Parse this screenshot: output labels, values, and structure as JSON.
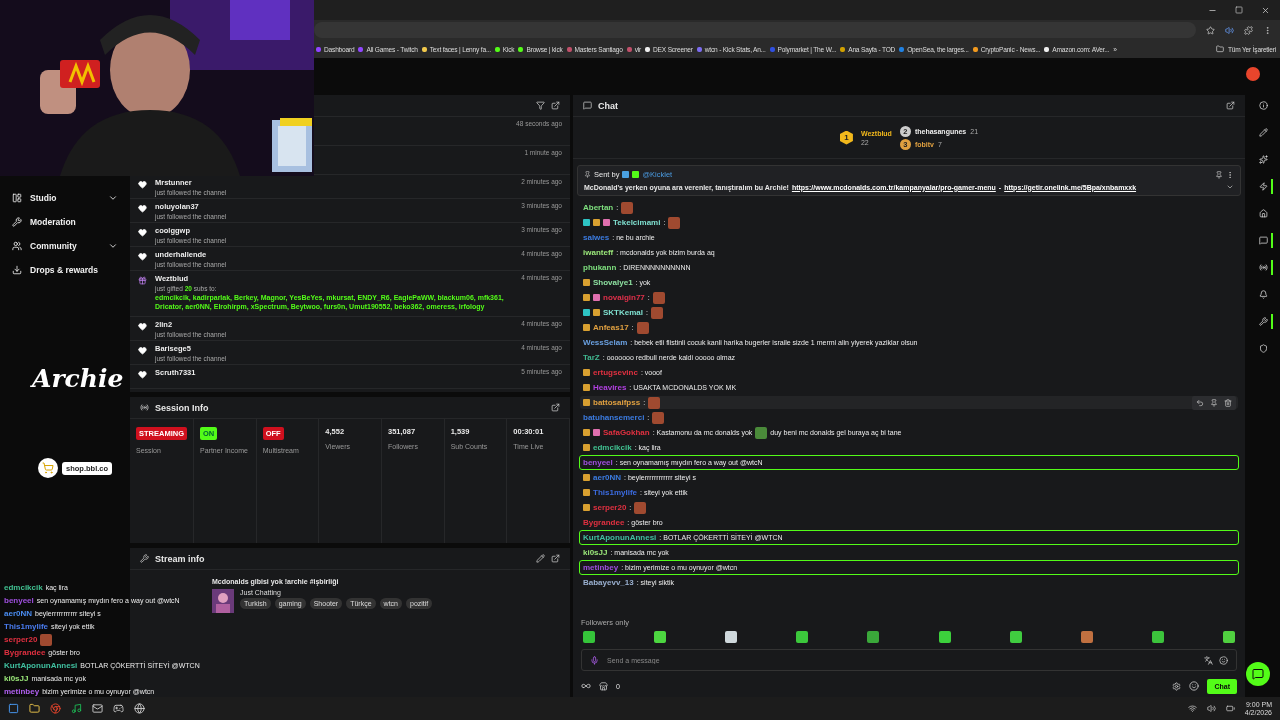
{
  "bookmarks": [
    {
      "label": "Dashboard"
    },
    {
      "label": "All Games - Twitch"
    },
    {
      "label": "Text faces | Lenny fa..."
    },
    {
      "label": "Kick"
    },
    {
      "label": "Browse | kick"
    },
    {
      "label": "Masters Santiago"
    },
    {
      "label": "vlr"
    },
    {
      "label": "DEX Screener"
    },
    {
      "label": "wtcn - Kick Stats, An..."
    },
    {
      "label": "Polymarket | The W..."
    },
    {
      "label": "Ana Sayfa - TOD"
    },
    {
      "label": "OpenSea, the larges..."
    },
    {
      "label": "CryptoPanic - News..."
    },
    {
      "label": "Amazon.com: AVer..."
    }
  ],
  "bookmarks_more": "»",
  "bookmarks_all": "Tüm Yer İşaretleri",
  "sidebar": {
    "items": [
      {
        "label": "Studio",
        "has_submenu": true
      },
      {
        "label": "Moderation",
        "has_submenu": false
      },
      {
        "label": "Community",
        "has_submenu": true
      },
      {
        "label": "Drops & rewards",
        "has_submenu": false
      }
    ]
  },
  "activity_feed": {
    "items": [
      {
        "kind": "hidden",
        "time": "48 seconds ago"
      },
      {
        "kind": "hidden",
        "time": "1 minute ago"
      },
      {
        "kind": "follow",
        "name": "Mrstunner",
        "note": "just followed the channel",
        "time": "2 minutes ago"
      },
      {
        "kind": "follow",
        "name": "noluyolan37",
        "note": "just followed the channel",
        "time": "3 minutes ago"
      },
      {
        "kind": "follow",
        "name": "coolggwp",
        "note": "just followed the channel",
        "time": "3 minutes ago"
      },
      {
        "kind": "follow",
        "name": "underhallende",
        "note": "just followed the channel",
        "time": "4 minutes ago"
      },
      {
        "kind": "gift",
        "name": "Weztblud",
        "note": "just gifted **20** subs to:",
        "recipients": "edmcikcik, kadirparlak, Berkey, Magnor, YesBeYes, mkursat, ENDY_R6, EaglePaWW, blackum06, mfk361, Dricator, aer0NN, Elrohirpm, xSpectrum, Beytwoo, furs0n, Umut190552, beko362, omeress, irfology",
        "time": "4 minutes ago"
      },
      {
        "kind": "follow",
        "name": "2lin2",
        "note": "just followed the channel",
        "time": "4 minutes ago"
      },
      {
        "kind": "follow",
        "name": "Barisege5",
        "note": "just followed the channel",
        "time": "4 minutes ago"
      },
      {
        "kind": "follow",
        "name": "Scruth7331",
        "time": "5 minutes ago"
      }
    ]
  },
  "session_info": {
    "title": "Session Info",
    "cells": [
      {
        "kind": "badge",
        "badge": "STREAMING",
        "color": "#d0101e",
        "label": "Session"
      },
      {
        "kind": "badge",
        "badge": "ON",
        "color": "#53fc18",
        "label": "Partner Income"
      },
      {
        "kind": "badge",
        "badge": "OFF",
        "color": "#d0101e",
        "label": "Multistream"
      },
      {
        "kind": "stat",
        "value": "4,552",
        "label": "Viewers"
      },
      {
        "kind": "stat",
        "value": "351,087",
        "label": "Followers"
      },
      {
        "kind": "stat",
        "value": "1,539",
        "label": "Sub Counts"
      },
      {
        "kind": "stat",
        "value": "00:30:01",
        "label": "Time Live"
      }
    ]
  },
  "stream_info": {
    "title": "Stream info",
    "stream_title": "Mcdonalds gibisi yok !archie #işbirliği",
    "category": "Just Chatting",
    "tags": [
      "Turkish",
      "gaming",
      "Shooter",
      "Türkçe",
      "wtcn",
      "pozitif"
    ]
  },
  "overlay": {
    "logo": "Archie",
    "shop": "shop.bbl.co",
    "chat": [
      {
        "user": "edmcikcik",
        "color": "#40c090",
        "text": "kaç lira"
      },
      {
        "user": "benyeel",
        "color": "#a050e0",
        "text": "sen oynamamış mıydın fero a way out @wtcN"
      },
      {
        "user": "aer0NN",
        "color": "#4a8cf0",
        "text": "beylerrrrrrrrrrr siteyi s"
      },
      {
        "user": "This1mylife",
        "color": "#4a7cf0",
        "text": "siteyi yok ettik"
      },
      {
        "user": "serper20",
        "color": "#e03040",
        "emote": true
      },
      {
        "user": "Bygrandee",
        "color": "#e03040",
        "text": "göster bro"
      },
      {
        "user": "KurtAponunAnnesi",
        "color": "#40c0a0",
        "text": "BOTLAR ÇÖKERTTİ SİTEYİ @WTCN"
      },
      {
        "user": "ki0sJJ",
        "color": "#9be87a",
        "text": "manisada mc yok"
      },
      {
        "user": "metinbey",
        "color": "#b060f0",
        "text": "bizim yerimize o mu oynuyor @wtcn"
      }
    ]
  },
  "chat": {
    "title": "Chat",
    "leaderboard": [
      {
        "rank": "1",
        "name": "Weztblud",
        "count": "22"
      },
      {
        "rank": "2",
        "name": "thehasangunes",
        "count": "21"
      },
      {
        "rank": "3",
        "name": "fobitv",
        "count": "7"
      }
    ],
    "pinned": {
      "sent_by": "Sent by",
      "author": "@Kicklet",
      "text": "McDonald's yerken oyuna ara verenler, tanıştıralım bu Archie!",
      "link": "https://www.mcdonalds.com.tr/kampanyalar/pro-gamer-menu",
      "separator": "-",
      "link_2": "https://getir.onelink.me/5Bpa/xnbamxxk"
    },
    "messages": [
      {
        "user": "Abertan",
        "color": "#7ee07e",
        "text": ":",
        "emote": true,
        "highlighted": false,
        "hovered": false
      },
      {
        "user": "Tekelcimami",
        "color": "#7fe0d0",
        "badges": [
          {
            "kind": "vip"
          },
          {
            "kind": "rank"
          },
          {
            "kind": "gift"
          }
        ],
        "text": ":",
        "emote": true,
        "highlighted": false,
        "hovered": false
      },
      {
        "user": "salwes",
        "color": "#3b7be0",
        "text": ": ne bu archie",
        "emote": false,
        "highlighted": false,
        "hovered": false
      },
      {
        "user": "iwanteff",
        "color": "#9be87a",
        "text": ": mcdonalds yok bizim burda aq",
        "emote": false,
        "highlighted": false,
        "hovered": false
      },
      {
        "user": "phukann",
        "color": "#7ee07e",
        "text": ": DIRENNNNNNNNNN",
        "emote": false,
        "highlighted": false,
        "hovered": false
      },
      {
        "user": "Shovalye1",
        "color": "#8de0a0",
        "badges": [
          {
            "kind": "rank"
          }
        ],
        "text": ": yok",
        "emote": false,
        "highlighted": false,
        "hovered": false
      },
      {
        "user": "novaigin77",
        "color": "#e0304a",
        "badges": [
          {
            "kind": "rank"
          },
          {
            "kind": "gift"
          }
        ],
        "text": ":",
        "emote": true,
        "highlighted": false,
        "hovered": false
      },
      {
        "user": "SKTKemal",
        "color": "#7fe0d0",
        "badges": [
          {
            "kind": "vip"
          },
          {
            "kind": "rank"
          }
        ],
        "text": ":",
        "emote": true,
        "highlighted": false,
        "hovered": false
      },
      {
        "user": "Anfeas17",
        "color": "#e0a040",
        "badges": [
          {
            "kind": "rank"
          }
        ],
        "text": ":",
        "emote": true,
        "highlighted": false,
        "hovered": false
      },
      {
        "user": "WessSelam",
        "color": "#6aa0e0",
        "text": ": bebek etli flistinli cocuk kanli harika bugerler israile sizde 1 mermi alin yiyerek yaziklar olsun",
        "emote": false,
        "highlighted": false,
        "hovered": false
      },
      {
        "user": "TarZ",
        "color": "#40b890",
        "text": ": ooooooo redbull nerde kaldi ooooo olmaz",
        "emote": false,
        "highlighted": false,
        "hovered": false
      },
      {
        "user": "ertugsevinc",
        "color": "#e03040",
        "badges": [
          {
            "kind": "rank"
          }
        ],
        "text": ": vooof",
        "emote": false,
        "highlighted": false,
        "hovered": false
      },
      {
        "user": "Heavires",
        "color": "#b040e0",
        "badges": [
          {
            "kind": "rank"
          }
        ],
        "text": ": USAKTA MCDONALDS YOK MK",
        "emote": false,
        "highlighted": false,
        "hovered": false
      },
      {
        "user": "battosaifpss",
        "color": "#e0a040",
        "badges": [
          {
            "kind": "rank"
          }
        ],
        "text": ":",
        "emote": true,
        "highlighted": false,
        "hovered": true
      },
      {
        "user": "batuhansemerci",
        "color": "#3b7be0",
        "text": ":",
        "emote": true,
        "highlighted": false,
        "hovered": false
      },
      {
        "user": "SafaGokhan",
        "color": "#e03040",
        "badges": [
          {
            "kind": "rank"
          },
          {
            "kind": "gift"
          }
        ],
        "text": ": Kastamonu da mc donalds yok",
        "emote": true,
        "text_after": "duy beni mc donalds gel buraya aç bi tane",
        "highlighted": false,
        "hovered": false
      },
      {
        "user": "edmcikcik",
        "color": "#40c090",
        "badges": [
          {
            "kind": "rank"
          }
        ],
        "text": ": kaç lira",
        "emote": false,
        "highlighted": false,
        "hovered": false
      },
      {
        "user": "benyeel",
        "color": "#a050e0",
        "text": ": sen oynamamış mıydın fero a way out @wtcN",
        "emote": false,
        "highlighted": true,
        "hovered": false
      },
      {
        "user": "aer0NN",
        "color": "#3b7be0",
        "badges": [
          {
            "kind": "rank"
          }
        ],
        "text": ": beylerrrrrrrrrrrr siteyi s",
        "emote": false,
        "highlighted": false,
        "hovered": false
      },
      {
        "user": "This1mylife",
        "color": "#3b6be0",
        "badges": [
          {
            "kind": "rank"
          }
        ],
        "text": ": siteyi yok ettik",
        "emote": false,
        "highlighted": false,
        "hovered": false
      },
      {
        "user": "serper20",
        "color": "#e03040",
        "badges": [
          {
            "kind": "rank"
          }
        ],
        "text": ":",
        "emote": true,
        "highlighted": false,
        "hovered": false
      },
      {
        "user": "Bygrandee",
        "color": "#e03040",
        "text": ": göster bro",
        "emote": false,
        "highlighted": false,
        "hovered": false
      },
      {
        "user": "KurtAponunAnnesi",
        "color": "#40c0a0",
        "text": ": BOTLAR ÇÖKERTTİ SİTEYİ @WTCN",
        "emote": false,
        "highlighted": true,
        "hovered": false
      },
      {
        "user": "ki0sJJ",
        "color": "#9be87a",
        "text": ": manisada mc yok",
        "emote": false,
        "highlighted": false,
        "hovered": false
      },
      {
        "user": "metinbey",
        "color": "#a050e0",
        "text": ": bizim yerimize o mu oynuyor @wtcn",
        "emote": false,
        "highlighted": true,
        "hovered": false
      },
      {
        "user": "Babayevv_13",
        "color": "#9ab0d0",
        "text": ": siteyi siktik",
        "emote": false,
        "highlighted": false,
        "hovered": false
      }
    ],
    "followers_only": "Followers only",
    "input": {
      "placeholder": "Send a message"
    },
    "store_count": "0",
    "send": "Chat"
  },
  "rail": [
    {
      "highlighted": false
    },
    {
      "highlighted": false
    },
    {
      "highlighted": false
    },
    {
      "highlighted": true
    },
    {
      "highlighted": false
    },
    {
      "highlighted": true
    },
    {
      "highlighted": true
    },
    {
      "highlighted": false
    },
    {
      "highlighted": true
    },
    {
      "highlighted": false
    }
  ],
  "taskbar": {
    "time": "9:00 PM",
    "date": "4/2/2026"
  }
}
